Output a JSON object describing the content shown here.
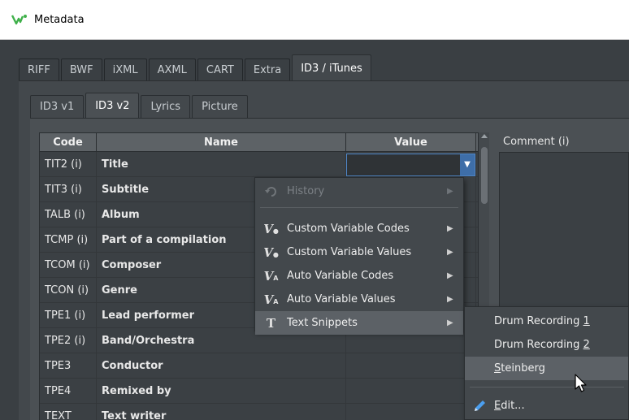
{
  "window": {
    "title": "Metadata",
    "icon": "wavelab-logo-icon"
  },
  "top_tabs": [
    "RIFF",
    "BWF",
    "iXML",
    "AXML",
    "CART",
    "Extra",
    "ID3 / iTunes"
  ],
  "top_tabs_active": "ID3 / iTunes",
  "sub_tabs": [
    "ID3 v1",
    "ID3 v2",
    "Lyrics",
    "Picture"
  ],
  "sub_tabs_active": "ID3 v2",
  "table": {
    "headers": [
      "Code",
      "Name",
      "Value"
    ],
    "rows": [
      {
        "code": "TIT2 (i)",
        "name": "Title"
      },
      {
        "code": "TIT3 (i)",
        "name": "Subtitle"
      },
      {
        "code": "TALB (i)",
        "name": "Album"
      },
      {
        "code": "TCMP (i)",
        "name": "Part of a compilation"
      },
      {
        "code": "TCOM (i)",
        "name": "Composer"
      },
      {
        "code": "TCON (i)",
        "name": "Genre"
      },
      {
        "code": "TPE1 (i)",
        "name": "Lead performer"
      },
      {
        "code": "TPE2 (i)",
        "name": "Band/Orchestra"
      },
      {
        "code": "TPE3",
        "name": "Conductor"
      },
      {
        "code": "TPE4",
        "name": "Remixed by"
      },
      {
        "code": "TEXT",
        "name": "Text writer"
      }
    ]
  },
  "comment_label": "Comment (i)",
  "context_menu": {
    "items": [
      {
        "label": "History",
        "icon": "history-icon",
        "disabled": true
      },
      {
        "label": "Custom Variable Codes",
        "icon": "custom-variable-icon"
      },
      {
        "label": "Custom Variable Values",
        "icon": "custom-variable-icon"
      },
      {
        "label": "Auto Variable Codes",
        "icon": "auto-variable-icon"
      },
      {
        "label": "Auto Variable Values",
        "icon": "auto-variable-icon"
      },
      {
        "label": "Text Snippets",
        "icon": "text-icon",
        "highlighted": true
      }
    ]
  },
  "submenu": {
    "items": [
      {
        "label": "Drum Recording ",
        "accel": "1"
      },
      {
        "label": "Drum Recording ",
        "accel": "2"
      },
      {
        "label": "",
        "accel": "S",
        "rest": "teinberg",
        "hover": true
      },
      {
        "label": "",
        "accel": "E",
        "rest": "dit...",
        "icon": "pencil-icon"
      }
    ]
  },
  "colors": {
    "accent": "#3e6ea8",
    "background": "#3a3f43"
  }
}
